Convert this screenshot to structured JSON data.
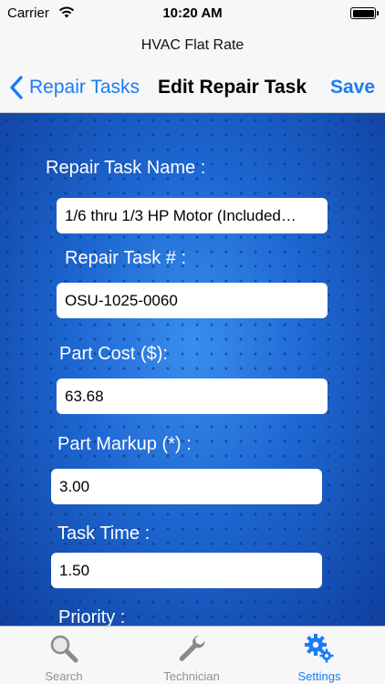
{
  "status_bar": {
    "carrier": "Carrier",
    "time": "10:20 AM"
  },
  "app": {
    "title": "HVAC Flat Rate"
  },
  "nav": {
    "back_label": "Repair Tasks",
    "title": "Edit Repair Task",
    "save_label": "Save"
  },
  "form": {
    "task_name_label": "Repair Task Name :",
    "task_name_value": "1/6 thru 1/3 HP Motor (Included…",
    "task_number_label": "Repair Task # :",
    "task_number_value": "OSU-1025-0060",
    "part_cost_label": "Part Cost ($):",
    "part_cost_value": "63.68",
    "part_markup_label": "Part Markup (*) :",
    "part_markup_value": "3.00",
    "task_time_label": "Task Time :",
    "task_time_value": "1.50",
    "priority_label": "Priority :"
  },
  "tabs": [
    {
      "label": "Search",
      "icon": "search-icon",
      "active": false
    },
    {
      "label": "Technician",
      "icon": "wrench-icon",
      "active": false
    },
    {
      "label": "Settings",
      "icon": "gears-icon",
      "active": true
    }
  ],
  "colors": {
    "accent": "#1a7cf6",
    "background": "#1d62c9",
    "inactive_tab": "#929292"
  }
}
